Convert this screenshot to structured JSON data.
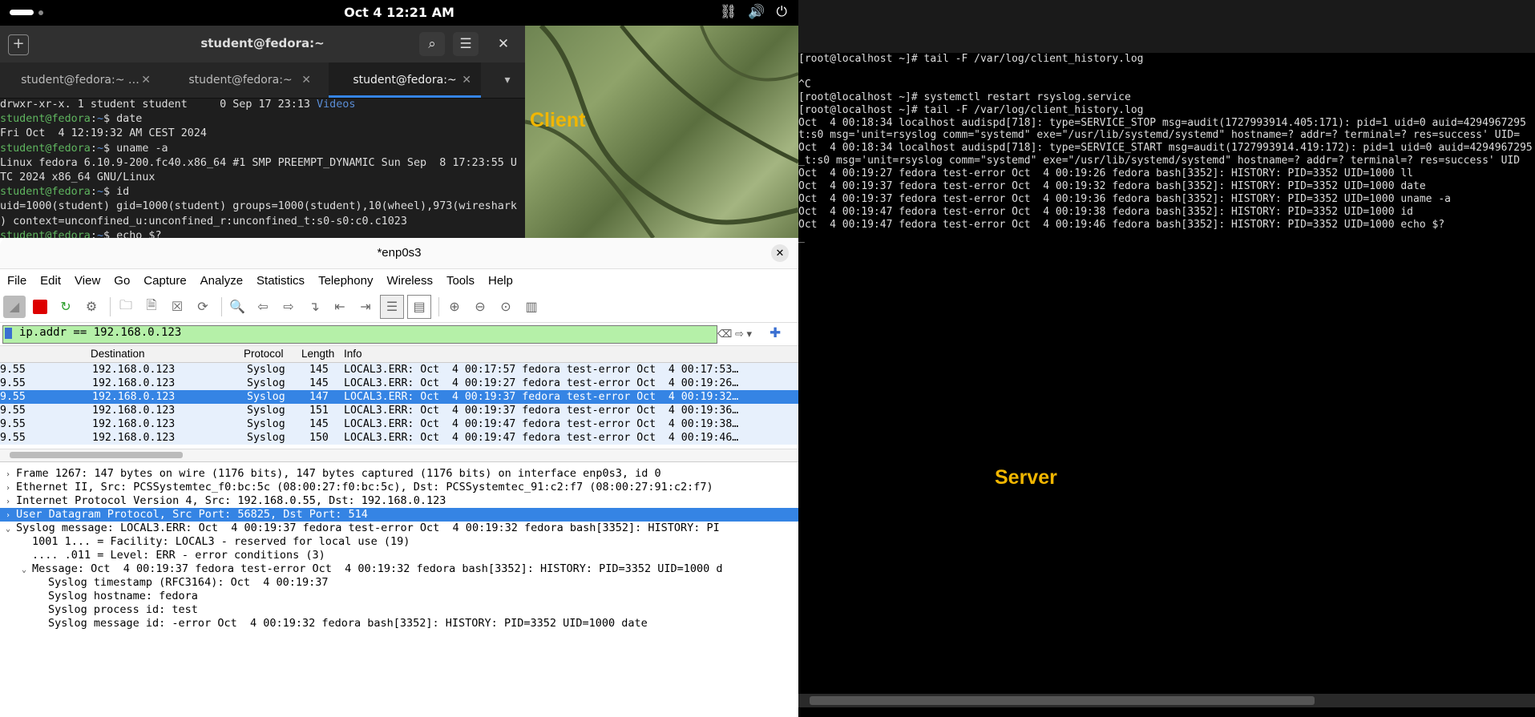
{
  "topbar": {
    "clock": "Oct 4  12:21 AM"
  },
  "client_label": "Client",
  "server_label": "Server",
  "terminal": {
    "title": "student@fedora:~",
    "tabs": [
      "student@fedora:~ …",
      "student@fedora:~",
      "student@fedora:~"
    ],
    "lines": [
      {
        "parts": [
          {
            "t": "drwxr-xr-x. 1 student student     0 Sep 17 23:13 ",
            "c": ""
          },
          {
            "t": "Videos",
            "c": "blue"
          }
        ]
      },
      {
        "parts": [
          {
            "t": "student@fedora",
            "c": "prompt"
          },
          {
            "t": ":",
            "c": ""
          },
          {
            "t": "~",
            "c": "path"
          },
          {
            "t": "$ date",
            "c": ""
          }
        ]
      },
      {
        "parts": [
          {
            "t": "Fri Oct  4 12:19:32 AM CEST 2024",
            "c": ""
          }
        ]
      },
      {
        "parts": [
          {
            "t": "student@fedora",
            "c": "prompt"
          },
          {
            "t": ":",
            "c": ""
          },
          {
            "t": "~",
            "c": "path"
          },
          {
            "t": "$ uname -a",
            "c": ""
          }
        ]
      },
      {
        "parts": [
          {
            "t": "Linux fedora 6.10.9-200.fc40.x86_64 #1 SMP PREEMPT_DYNAMIC Sun Sep  8 17:23:55 U",
            "c": ""
          }
        ]
      },
      {
        "parts": [
          {
            "t": "TC 2024 x86_64 GNU/Linux",
            "c": ""
          }
        ]
      },
      {
        "parts": [
          {
            "t": "student@fedora",
            "c": "prompt"
          },
          {
            "t": ":",
            "c": ""
          },
          {
            "t": "~",
            "c": "path"
          },
          {
            "t": "$ id",
            "c": ""
          }
        ]
      },
      {
        "parts": [
          {
            "t": "uid=1000(student) gid=1000(student) groups=1000(student),10(wheel),973(wireshark",
            "c": ""
          }
        ]
      },
      {
        "parts": [
          {
            "t": ") context=unconfined_u:unconfined_r:unconfined_t:s0-s0:c0.c1023",
            "c": ""
          }
        ]
      },
      {
        "parts": [
          {
            "t": "student@fedora",
            "c": "prompt"
          },
          {
            "t": ":",
            "c": ""
          },
          {
            "t": "~",
            "c": "path"
          },
          {
            "t": "$ echo $?",
            "c": ""
          }
        ]
      }
    ]
  },
  "server": {
    "lines": [
      "[root@localhost ~]# tail -F /var/log/client_history.log",
      "",
      "^C",
      "[root@localhost ~]# systemctl restart rsyslog.service",
      "[root@localhost ~]# tail -F /var/log/client_history.log",
      "Oct  4 00:18:34 localhost audispd[718]: type=SERVICE_STOP msg=audit(1727993914.405:171): pid=1 uid=0 auid=4294967295",
      "t:s0 msg='unit=rsyslog comm=\"systemd\" exe=\"/usr/lib/systemd/systemd\" hostname=? addr=? terminal=? res=success' UID=",
      "Oct  4 00:18:34 localhost audispd[718]: type=SERVICE_START msg=audit(1727993914.419:172): pid=1 uid=0 auid=4294967295",
      "_t:s0 msg='unit=rsyslog comm=\"systemd\" exe=\"/usr/lib/systemd/systemd\" hostname=? addr=? terminal=? res=success' UID",
      "Oct  4 00:19:27 fedora test-error Oct  4 00:19:26 fedora bash[3352]: HISTORY: PID=3352 UID=1000 ll",
      "Oct  4 00:19:37 fedora test-error Oct  4 00:19:32 fedora bash[3352]: HISTORY: PID=3352 UID=1000 date",
      "Oct  4 00:19:37 fedora test-error Oct  4 00:19:36 fedora bash[3352]: HISTORY: PID=3352 UID=1000 uname -a",
      "Oct  4 00:19:47 fedora test-error Oct  4 00:19:38 fedora bash[3352]: HISTORY: PID=3352 UID=1000 id",
      "Oct  4 00:19:47 fedora test-error Oct  4 00:19:46 fedora bash[3352]: HISTORY: PID=3352 UID=1000 echo $?",
      "_"
    ]
  },
  "wireshark": {
    "title": "*enp0s3",
    "menu": [
      "File",
      "Edit",
      "View",
      "Go",
      "Capture",
      "Analyze",
      "Statistics",
      "Telephony",
      "Wireless",
      "Tools",
      "Help"
    ],
    "filter": "ip.addr == 192.168.0.123",
    "columns": {
      "destination": "Destination",
      "protocol": "Protocol",
      "length": "Length",
      "info": "Info"
    },
    "packets": [
      {
        "src": "9.55",
        "dst": "192.168.0.123",
        "proto": "Syslog",
        "len": "145",
        "info": "LOCAL3.ERR: Oct  4 00:17:57 fedora test-error Oct  4 00:17:53…",
        "selected": false
      },
      {
        "src": "9.55",
        "dst": "192.168.0.123",
        "proto": "Syslog",
        "len": "145",
        "info": "LOCAL3.ERR: Oct  4 00:19:27 fedora test-error Oct  4 00:19:26…",
        "selected": false
      },
      {
        "src": "9.55",
        "dst": "192.168.0.123",
        "proto": "Syslog",
        "len": "147",
        "info": "LOCAL3.ERR: Oct  4 00:19:37 fedora test-error Oct  4 00:19:32…",
        "selected": true
      },
      {
        "src": "9.55",
        "dst": "192.168.0.123",
        "proto": "Syslog",
        "len": "151",
        "info": "LOCAL3.ERR: Oct  4 00:19:37 fedora test-error Oct  4 00:19:36…",
        "selected": false
      },
      {
        "src": "9.55",
        "dst": "192.168.0.123",
        "proto": "Syslog",
        "len": "145",
        "info": "LOCAL3.ERR: Oct  4 00:19:47 fedora test-error Oct  4 00:19:38…",
        "selected": false
      },
      {
        "src": "9.55",
        "dst": "192.168.0.123",
        "proto": "Syslog",
        "len": "150",
        "info": "LOCAL3.ERR: Oct  4 00:19:47 fedora test-error Oct  4 00:19:46…",
        "selected": false
      }
    ],
    "details": [
      {
        "arrow": "›",
        "text": "Frame 1267: 147 bytes on wire (1176 bits), 147 bytes captured (1176 bits) on interface enp0s3, id 0",
        "indent": 0,
        "selected": false
      },
      {
        "arrow": "›",
        "text": "Ethernet II, Src: PCSSystemtec_f0:bc:5c (08:00:27:f0:bc:5c), Dst: PCSSystemtec_91:c2:f7 (08:00:27:91:c2:f7)",
        "indent": 0,
        "selected": false
      },
      {
        "arrow": "›",
        "text": "Internet Protocol Version 4, Src: 192.168.0.55, Dst: 192.168.0.123",
        "indent": 0,
        "selected": false
      },
      {
        "arrow": "›",
        "text": "User Datagram Protocol, Src Port: 56825, Dst Port: 514",
        "indent": 0,
        "selected": true
      },
      {
        "arrow": "⌄",
        "text": "Syslog message: LOCAL3.ERR: Oct  4 00:19:37 fedora test-error Oct  4 00:19:32 fedora bash[3352]: HISTORY: PI",
        "indent": 0,
        "selected": false
      },
      {
        "arrow": "",
        "text": "1001 1... = Facility: LOCAL3 - reserved for local use (19)",
        "indent": 1,
        "selected": false
      },
      {
        "arrow": "",
        "text": ".... .011 = Level: ERR - error conditions (3)",
        "indent": 1,
        "selected": false
      },
      {
        "arrow": "⌄",
        "text": "Message: Oct  4 00:19:37 fedora test-error Oct  4 00:19:32 fedora bash[3352]: HISTORY: PID=3352 UID=1000 d",
        "indent": 1,
        "selected": false
      },
      {
        "arrow": "",
        "text": "Syslog timestamp (RFC3164): Oct  4 00:19:37",
        "indent": 2,
        "selected": false
      },
      {
        "arrow": "",
        "text": "Syslog hostname: fedora",
        "indent": 2,
        "selected": false
      },
      {
        "arrow": "",
        "text": "Syslog process id: test",
        "indent": 2,
        "selected": false
      },
      {
        "arrow": "",
        "text": "Syslog message id: -error Oct  4 00:19:32 fedora bash[3352]: HISTORY: PID=3352 UID=1000 date",
        "indent": 2,
        "selected": false
      }
    ]
  }
}
